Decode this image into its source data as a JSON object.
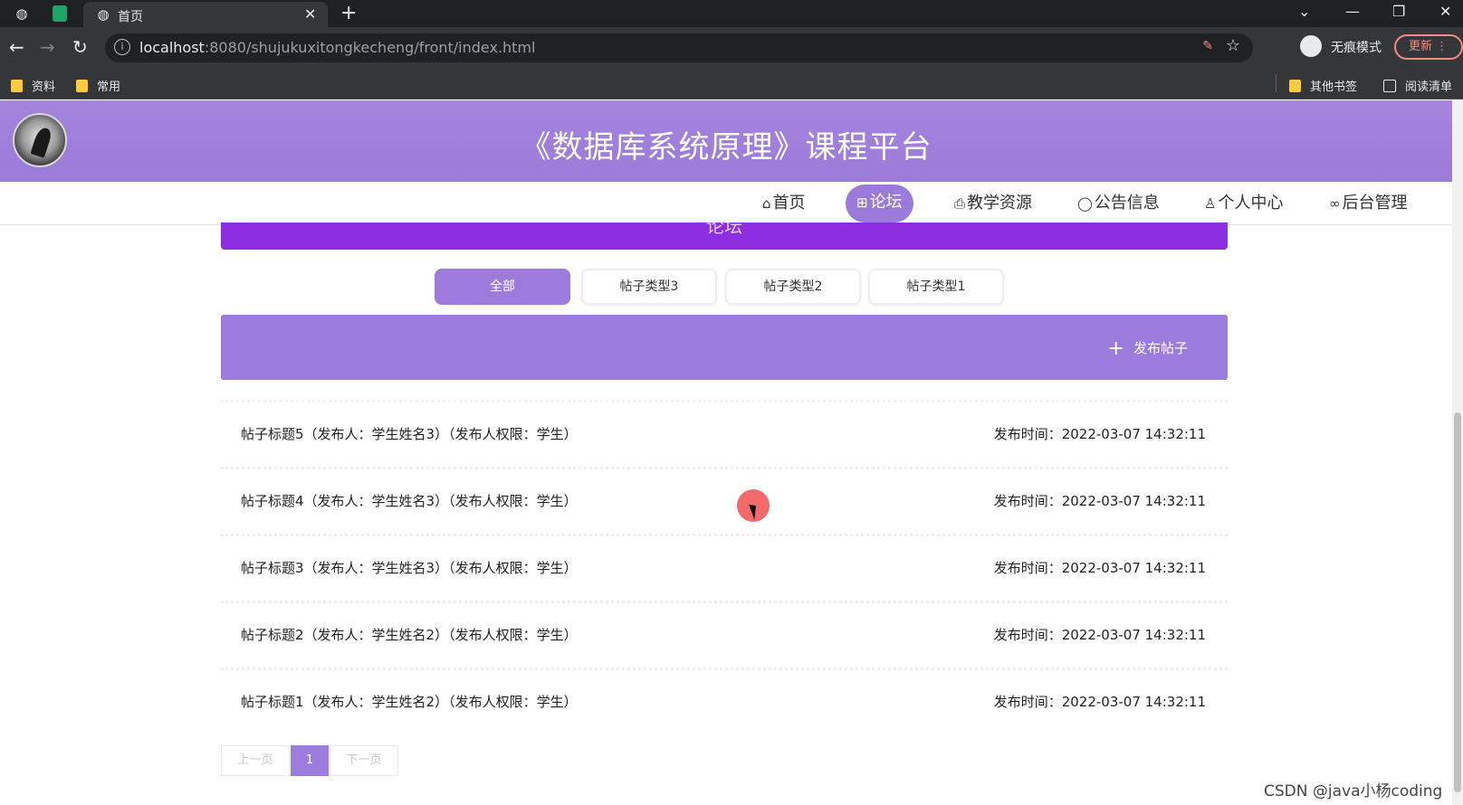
{
  "browser": {
    "tab_title": "首页",
    "url_host": "localhost",
    "url_path": ":8080/shujukuxitongkecheng/front/index.html",
    "incognito_label": "无痕模式",
    "update_label": "更新",
    "bookmarks": [
      "资料",
      "常用"
    ],
    "bookmarks_right": [
      "其他书签",
      "阅读清单"
    ]
  },
  "site": {
    "title": "《数据库系统原理》课程平台"
  },
  "nav": [
    {
      "icon": "home-icon",
      "label": "首页",
      "active": false
    },
    {
      "icon": "grid-icon",
      "label": "论坛",
      "active": true
    },
    {
      "icon": "printer-icon",
      "label": "教学资源",
      "active": false
    },
    {
      "icon": "notice-icon",
      "label": "公告信息",
      "active": false
    },
    {
      "icon": "user-icon",
      "label": "个人中心",
      "active": false
    },
    {
      "icon": "link-icon",
      "label": "后台管理",
      "active": false
    }
  ],
  "forum": {
    "banner": "论坛",
    "types": [
      "全部",
      "帖子类型3",
      "帖子类型2",
      "帖子类型1"
    ],
    "active_type": "全部",
    "post_button": "发布帖子",
    "posts": [
      {
        "title": "帖子标题5（发布人：学生姓名3）（发布人权限：学生）",
        "time": "发布时间：2022-03-07 14:32:11"
      },
      {
        "title": "帖子标题4（发布人：学生姓名3）（发布人权限：学生）",
        "time": "发布时间：2022-03-07 14:32:11"
      },
      {
        "title": "帖子标题3（发布人：学生姓名3）（发布人权限：学生）",
        "time": "发布时间：2022-03-07 14:32:11"
      },
      {
        "title": "帖子标题2（发布人：学生姓名2）（发布人权限：学生）",
        "time": "发布时间：2022-03-07 14:32:11"
      },
      {
        "title": "帖子标题1（发布人：学生姓名2）（发布人权限：学生）",
        "time": "发布时间：2022-03-07 14:32:11"
      }
    ]
  },
  "pagination": {
    "prev": "上一页",
    "current": "1",
    "next": "下一页"
  },
  "colors": {
    "primary": "#9b7bdc",
    "banner": "#8d2fe0",
    "header": "#a484dd"
  },
  "watermark": "CSDN @java小杨coding"
}
